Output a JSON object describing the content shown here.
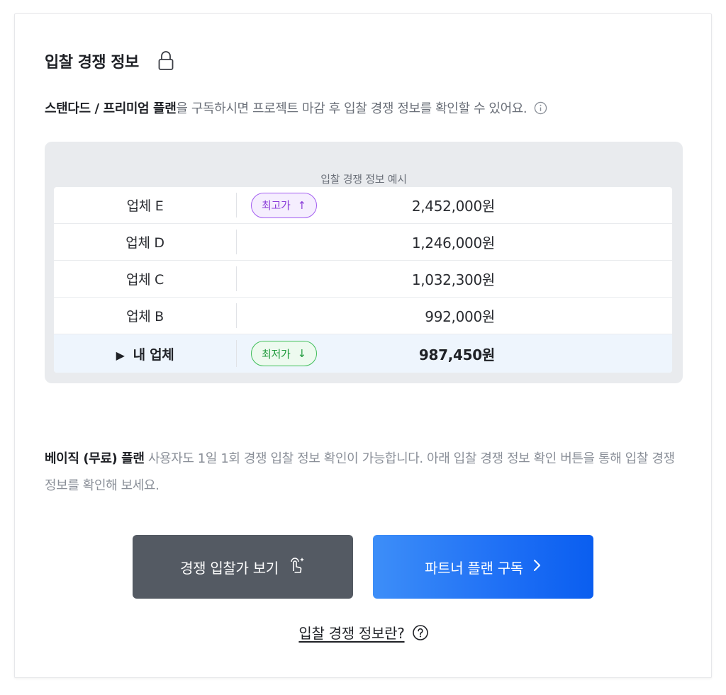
{
  "header": {
    "title": "입찰 경쟁 정보"
  },
  "description": {
    "strong": "스탠다드 / 프리미엄 플랜",
    "rest": "을 구독하시면 프로젝트 마감 후 입찰 경쟁 정보를 확인할 수 있어요."
  },
  "example": {
    "caption": "입찰 경쟁 정보 예시",
    "rows": [
      {
        "name": "업체 E",
        "badge": "최고가",
        "badge_arrow": "↑",
        "price": "2,452,000원"
      },
      {
        "name": "업체 D",
        "price": "1,246,000원"
      },
      {
        "name": "업체 C",
        "price": "1,032,300원"
      },
      {
        "name": "업체 B",
        "price": "992,000원"
      },
      {
        "name": "내 업체",
        "badge": "최저가",
        "badge_arrow": "↓",
        "price": "987,450원"
      }
    ],
    "mine_marker": "▶"
  },
  "basic": {
    "strong": "베이직 (무료) 플랜",
    "rest": " 사용자도 1일 1회 경쟁 입찰 정보 확인이 가능합니다. 아래 입찰 경쟁 정보 확인 버튼을 통해 입찰 경쟁 정보를 확인해 보세요."
  },
  "buttons": {
    "view_label": "경쟁 입찰가 보기",
    "subscribe_label": "파트너 플랜 구독",
    "subscribe_arrow": "〉"
  },
  "help": {
    "label": "입찰 경쟁 정보란?"
  },
  "colors": {
    "primary_blue": "#1e6ff5",
    "dark_button": "#545a63",
    "high_badge": "#8b3fd9",
    "low_badge": "#1f9a3c"
  }
}
